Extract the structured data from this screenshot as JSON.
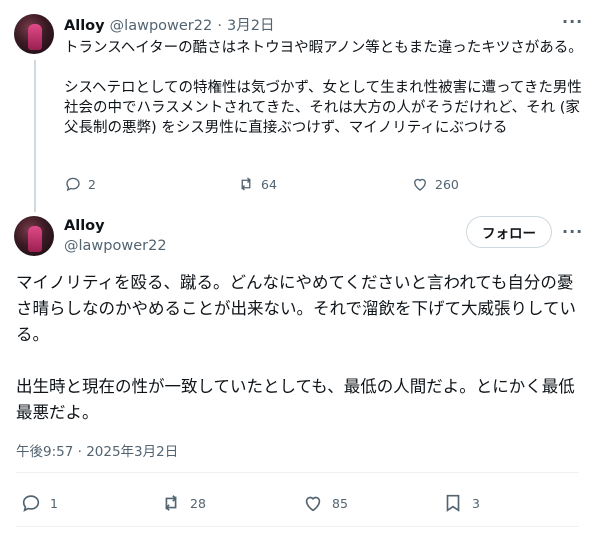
{
  "reply_tweet": {
    "display_name": "Alloy",
    "handle": "@lawpower22",
    "date": "3月2日",
    "separator": "·",
    "more_label": "···",
    "text": "トランスヘイターの酷さはネトウヨや暇アノン等ともまた違ったキツさがある。\n\nシスヘテロとしての特権性は気づかず、女として生まれ性被害に遭ってきた男性社会の中でハラスメントされてきた、それは大方の人がそうだけれど、それ (家父長制の悪弊) をシス男性に直接ぶつけず、マイノリティにぶつける",
    "actions": {
      "replies": "2",
      "reposts": "64",
      "likes": "260"
    }
  },
  "main_tweet": {
    "display_name": "Alloy",
    "handle": "@lawpower22",
    "follow_label": "フォロー",
    "more_label": "···",
    "text": "マイノリティを殴る、蹴る。どんなにやめてくださいと言われても自分の憂さ晴らしなのかやめることが出来ない。それで溜飲を下げて大威張りしている。\n\n出生時と現在の性が一致していたとしても、最低の人間だよ。とにかく最低最悪だよ。",
    "timestamp": "午後9:57 · 2025年3月2日",
    "actions": {
      "replies": "1",
      "reposts": "28",
      "likes": "85",
      "bookmarks": "3"
    }
  }
}
